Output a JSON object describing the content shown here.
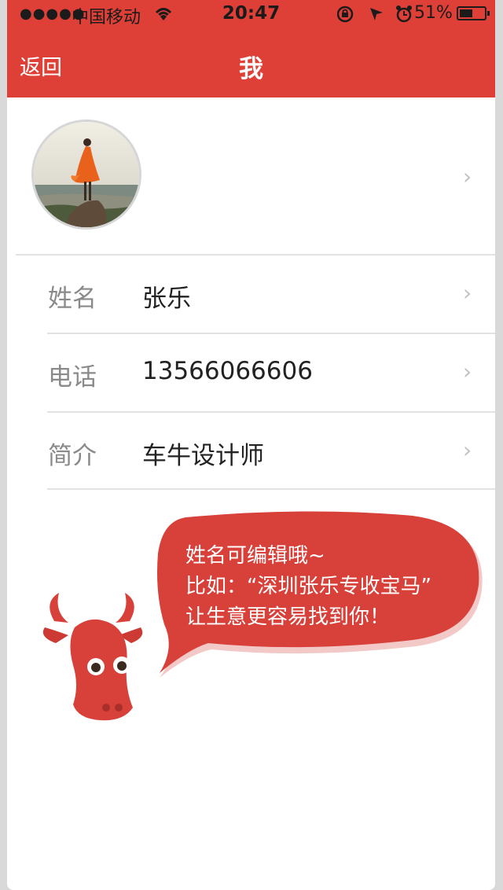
{
  "status_bar": {
    "signal": "●●●●●",
    "carrier": "中国移动",
    "time": "20:47",
    "battery_percent": "51%"
  },
  "nav": {
    "back_label": "返回",
    "title": "我"
  },
  "profile": {
    "rows": [
      {
        "label": "姓名",
        "value": "张乐"
      },
      {
        "label": "电话",
        "value": "13566066606"
      },
      {
        "label": "简介",
        "value": "车牛设计师"
      }
    ]
  },
  "tip": {
    "line1": "姓名可编辑哦~",
    "line2": "比如：“深圳张乐专收宝马”",
    "line3": "让生意更容易找到你！"
  },
  "colors": {
    "brand_red": "#de4037",
    "bubble_red": "#d8403a"
  }
}
